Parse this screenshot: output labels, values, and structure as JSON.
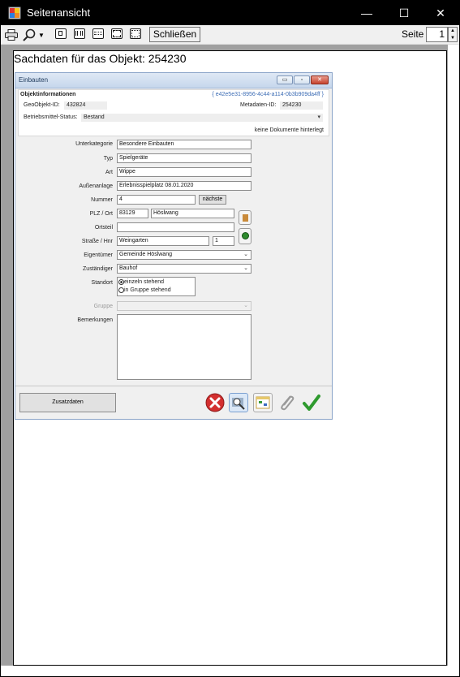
{
  "window": {
    "title": "Seitenansicht",
    "minimize": "—",
    "maximize": "☐",
    "close": "✕"
  },
  "toolbar": {
    "close_label": "Schließen",
    "page_label": "Seite",
    "page_value": "1"
  },
  "paper": {
    "heading": "Sachdaten für das Objekt: 254230"
  },
  "dialog": {
    "title": "Einbauten",
    "title_buttons": [
      "▭",
      "▫",
      "✕"
    ],
    "info": {
      "section": "Objektinformationen",
      "guid": "{ e42e5e31-8956-4c44-a114-0b3b909da4ff }",
      "geo_label": "GeoObjekt-ID:",
      "geo_value": "432824",
      "meta_label": "Metadaten-ID:",
      "meta_value": "254230",
      "status_label": "Betriebsmittel-Status:",
      "status_value": "Bestand",
      "docs": "keine Dokumente hinterlegt"
    },
    "form": {
      "unterkategorie_label": "Unterkategorie",
      "unterkategorie": "Besondere Einbauten",
      "typ_label": "Typ",
      "typ": "Spielgeräte",
      "art_label": "Art",
      "art": "Wippe",
      "aussenanlage_label": "Außenanlage",
      "aussenanlage": "Erlebnisspielplatz 08.01.2020",
      "nummer_label": "Nummer",
      "nummer": "4",
      "naechste": "nächste",
      "plz_label": "PLZ / Ort",
      "plz": "83129",
      "ort": "Höslwang",
      "ortsteil_label": "Ortsteil",
      "ortsteil": "",
      "strasse_label": "Straße / Hnr",
      "strasse": "Weingarten",
      "hnr": "1",
      "eigentuemer_label": "Eigentümer",
      "eigentuemer": "Gemeinde Höslwang",
      "zustaendiger_label": "Zuständiger",
      "zustaendiger": "Bauhof",
      "standort_label": "Standort",
      "standort_opt1": "einzeln stehend",
      "standort_opt2": "in Gruppe stehend",
      "gruppe_label": "Gruppe",
      "gruppe": "",
      "bemerkungen_label": "Bemerkungen",
      "bemerkungen": ""
    },
    "footer": {
      "zusatzdaten": "Zusatzdaten"
    }
  },
  "icons": {
    "app": "app-icon",
    "print": "printer-icon",
    "zoom": "magnifier-icon",
    "cancel": "red-x-icon",
    "map": "map-search-icon",
    "table": "table-icon",
    "attach": "paperclip-icon",
    "ok": "green-check-icon"
  }
}
